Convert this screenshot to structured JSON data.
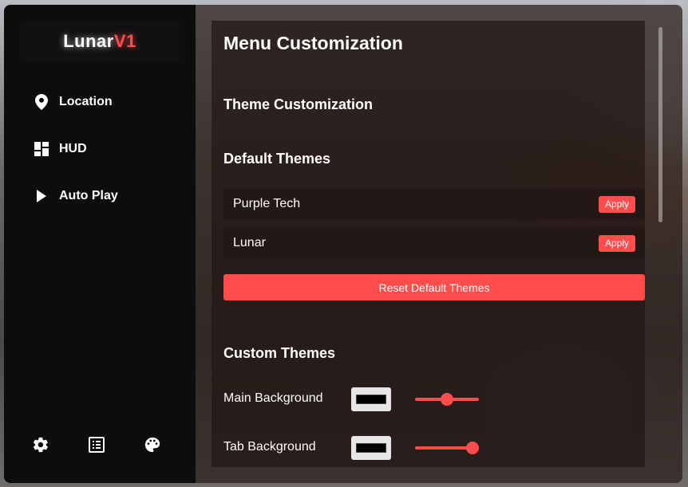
{
  "logo": {
    "part1": "Lunar",
    "part2": "V1"
  },
  "sidebar": {
    "items": [
      {
        "label": "Location",
        "icon": "location-pin-icon"
      },
      {
        "label": "HUD",
        "icon": "dashboard-icon"
      },
      {
        "label": "Auto Play",
        "icon": "play-icon"
      }
    ],
    "bottom_icons": [
      "gear-icon",
      "list-icon",
      "palette-icon"
    ]
  },
  "main": {
    "title": "Menu Customization",
    "theme_heading": "Theme Customization",
    "default_heading": "Default Themes",
    "default_themes": [
      {
        "name": "Purple Tech",
        "button": "Apply"
      },
      {
        "name": "Lunar",
        "button": "Apply"
      }
    ],
    "reset_label": "Reset Default Themes",
    "custom_heading": "Custom Themes",
    "custom_settings": [
      {
        "label": "Main Background",
        "color": "#000000",
        "slider_value": 0.5
      },
      {
        "label": "Tab Background",
        "color": "#000000",
        "slider_value": 0.9
      }
    ]
  },
  "colors": {
    "accent": "#ff4d4d",
    "sidebar_bg": "#0d0d0d"
  }
}
